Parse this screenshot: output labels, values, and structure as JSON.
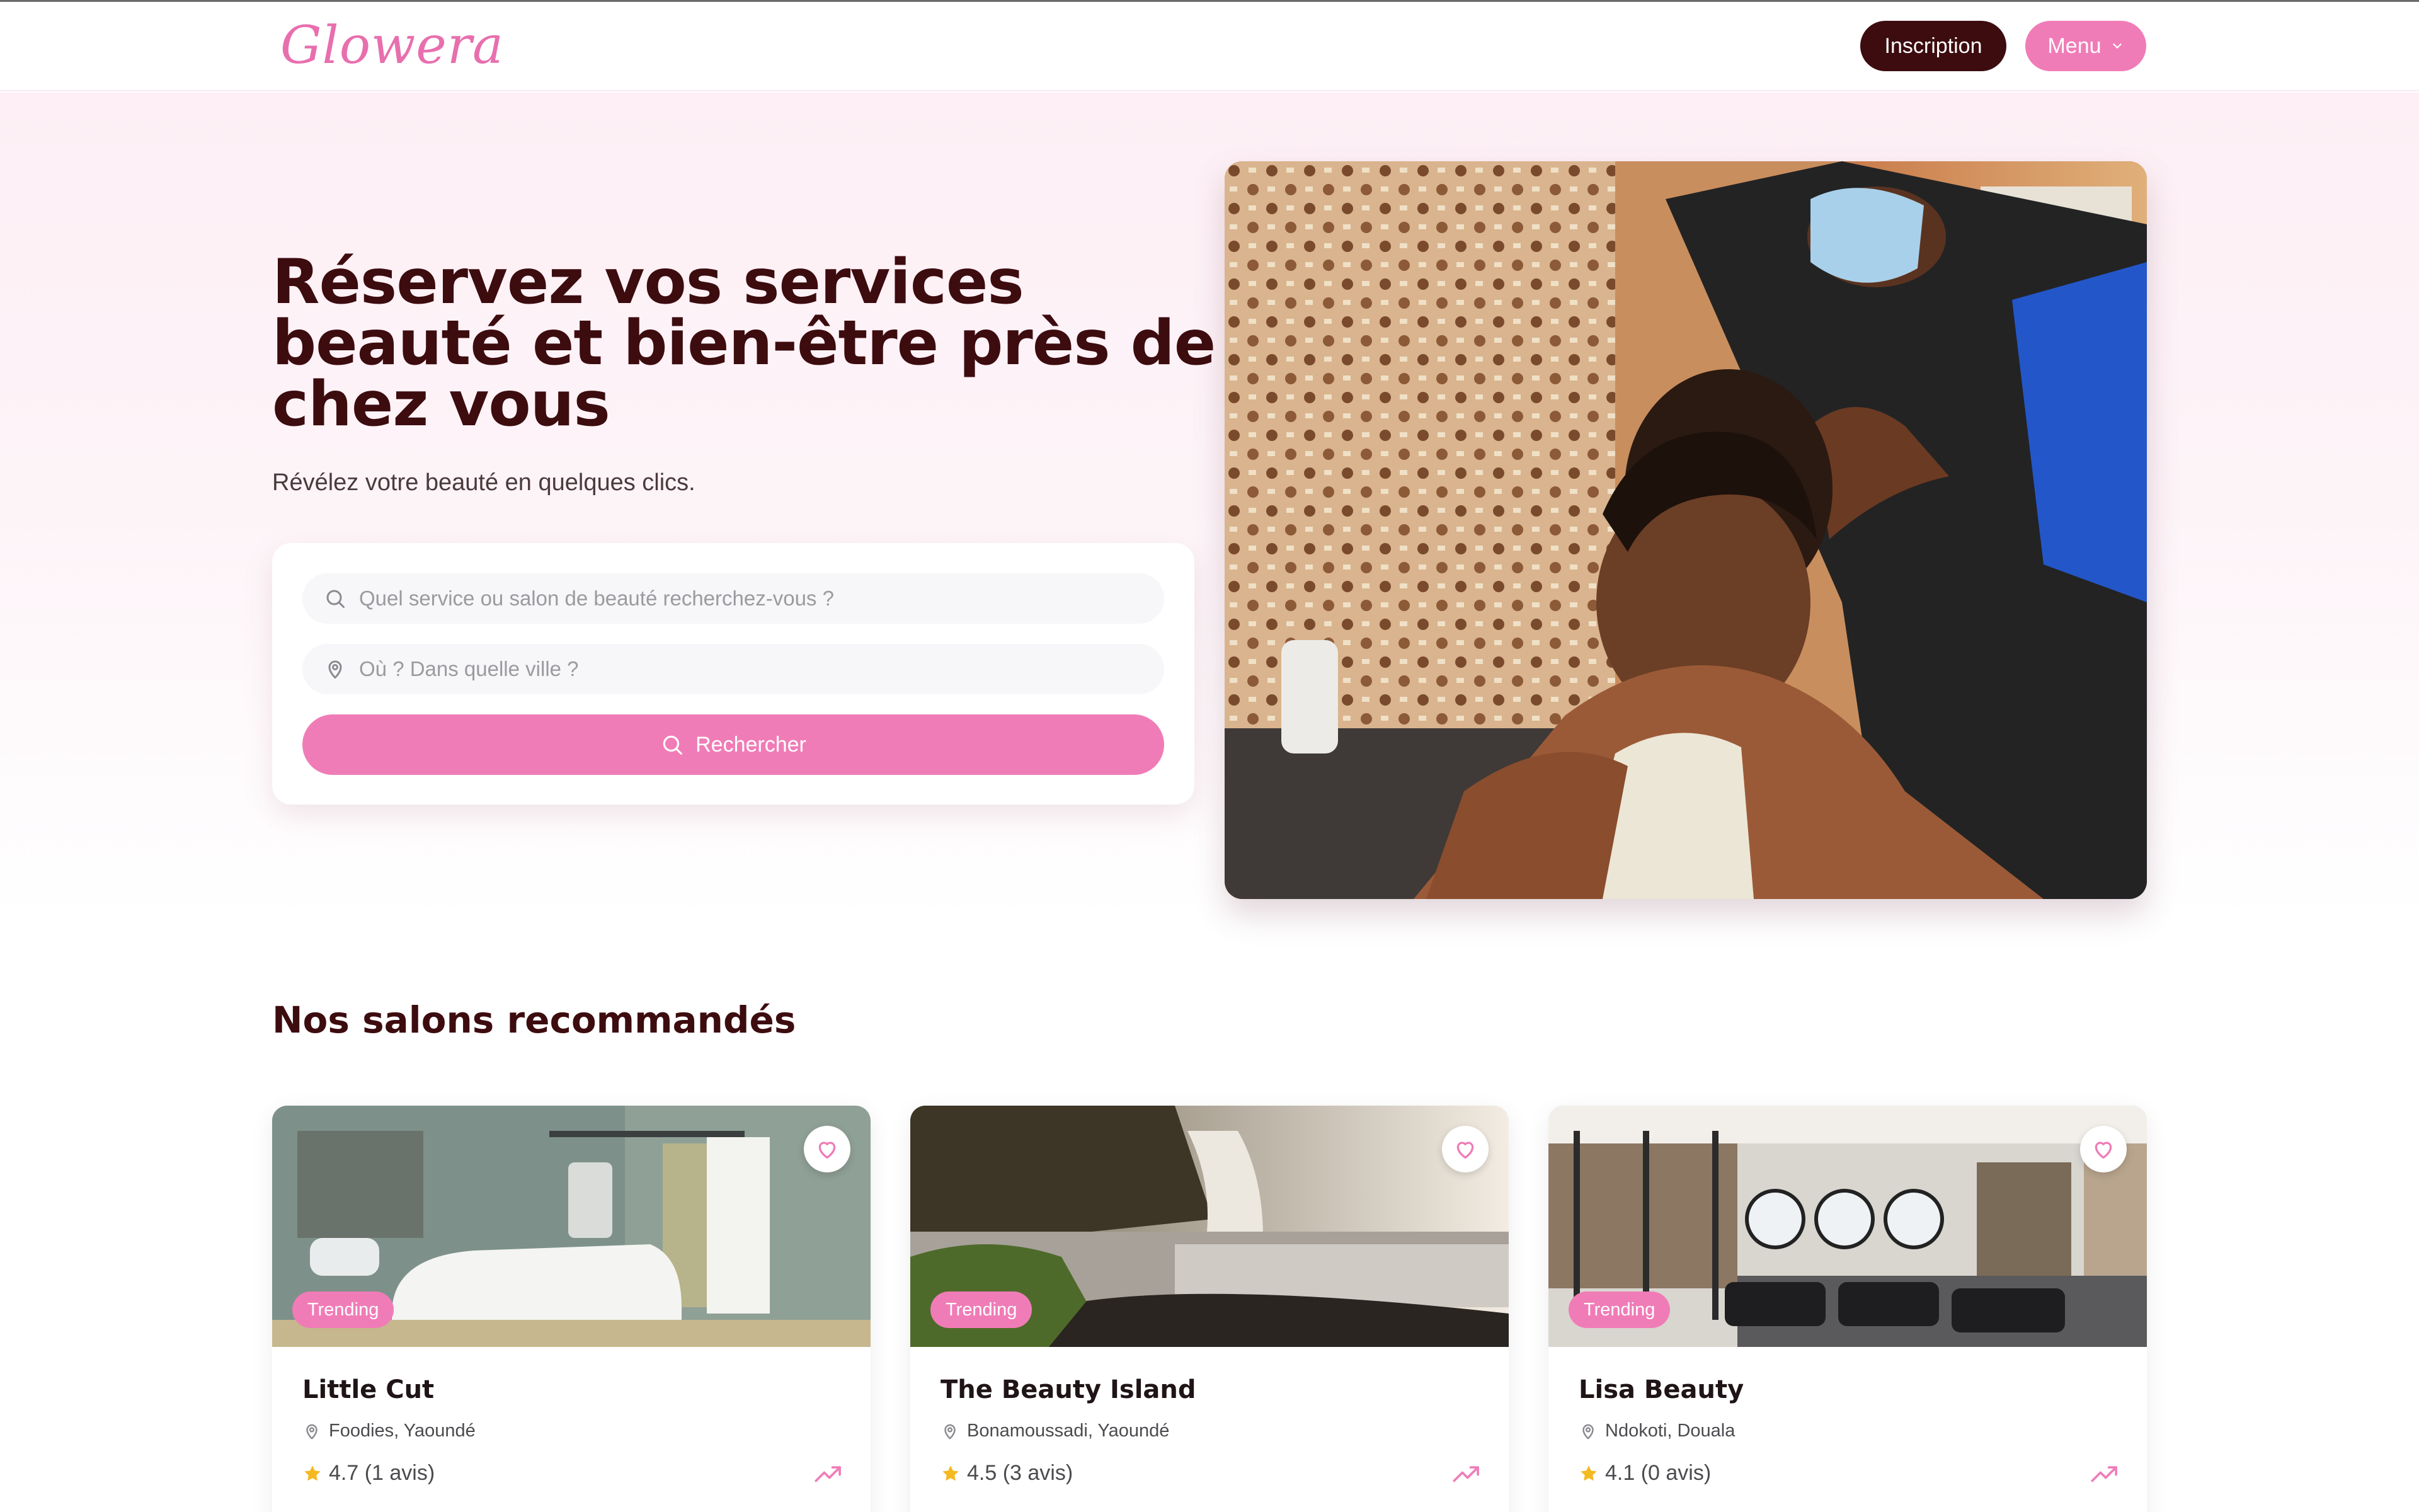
{
  "header": {
    "logo": "Glowera",
    "signup_label": "Inscription",
    "menu_label": "Menu"
  },
  "hero": {
    "title": "Réservez vos services beauté et bien-être près de chez vous",
    "subtitle": "Révélez votre beauté en quelques clics.",
    "search": {
      "service_placeholder": "Quel service ou salon de beauté recherchez-vous ?",
      "service_value": "",
      "location_placeholder": "Où ? Dans quelle ville ?",
      "location_value": "",
      "button_label": "Rechercher"
    }
  },
  "salons": {
    "title": "Nos salons recommandés",
    "items": [
      {
        "name": "Little Cut",
        "location": "Foodies, Yaoundé",
        "rating": "4.7 (1 avis)",
        "badge": "Trending"
      },
      {
        "name": "The Beauty Island",
        "location": "Bonamoussadi, Yaoundé",
        "rating": "4.5 (3 avis)",
        "badge": "Trending"
      },
      {
        "name": "Lisa Beauty",
        "location": "Ndokoti, Douala",
        "rating": "4.1 (0 avis)",
        "badge": "Trending"
      }
    ]
  },
  "icons": {
    "search": "search-icon",
    "location": "map-pin-icon",
    "favorite": "heart-icon",
    "rating": "star-icon",
    "trend": "trending-up-icon",
    "menu_chevron": "chevron-down-icon"
  },
  "colors": {
    "brand_pink": "#f07cb7",
    "brand_dark": "#3d0c0f",
    "star": "#f5b921"
  }
}
